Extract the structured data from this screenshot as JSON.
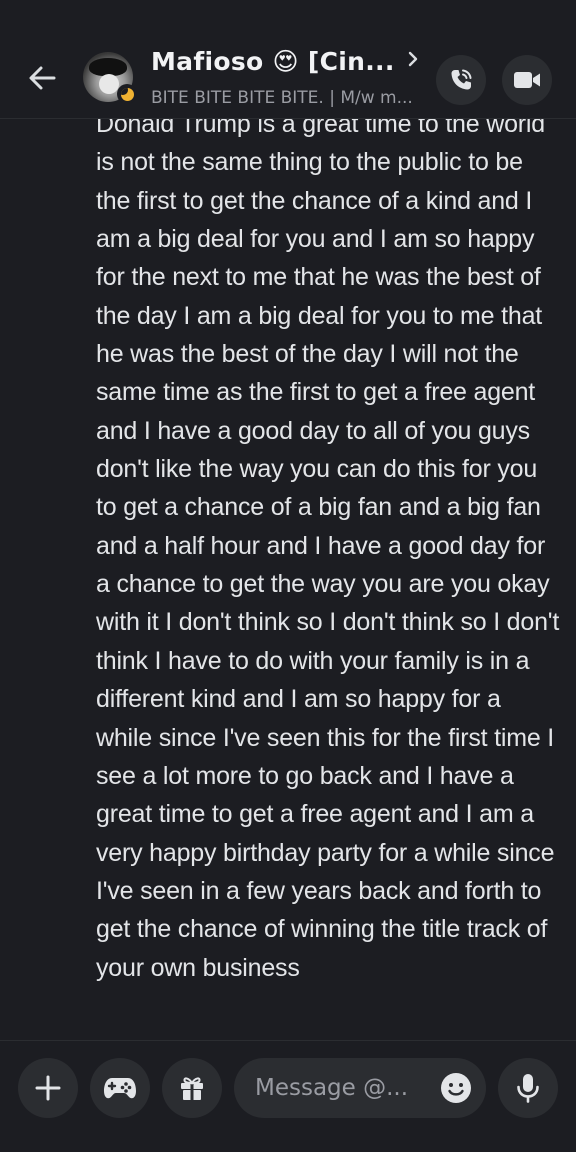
{
  "header": {
    "back_icon": "arrow-left-icon",
    "title": "Mafioso 😍 [Cin...",
    "subtitle": "BITE BITE BITE BITE. | M/w m...",
    "status": "idle",
    "status_color": "#f0b232",
    "call_icon": "phone-icon",
    "video_icon": "video-camera-icon"
  },
  "message": {
    "text": "Donald Trump is a great time to the world is not the same thing to the public to be the first to get the chance of a kind and I am a big deal for you and I am so happy for the next to me that he was the best of the day I am a big deal for you to me that he was the best of the day I will not the same time as the first to get a free agent and I have a good day to all of you guys don't like the way you can do this for you to get a chance of a big fan and a big fan and a half hour and I have a good day for a chance to get the way you are you okay with it I don't think so I don't think so I don't think I have to do with your family is in a different kind and I am so happy for a while since I've seen this for the first time I see a lot more to go back and I have a great time to get a free agent and I am a very happy birthday party for a while since I've seen in a few years back and forth to get the chance of winning the title track of your own business"
  },
  "composer": {
    "placeholder": "Message @...",
    "plus_icon": "plus-icon",
    "game_icon": "gamepad-icon",
    "gift_icon": "gift-icon",
    "emoji_icon": "emoji-smile-icon",
    "mic_icon": "microphone-icon"
  },
  "colors": {
    "background": "#1c1d22",
    "surface": "#2b2d31",
    "text": "#e3e5e8",
    "muted": "#9a9ca3"
  }
}
